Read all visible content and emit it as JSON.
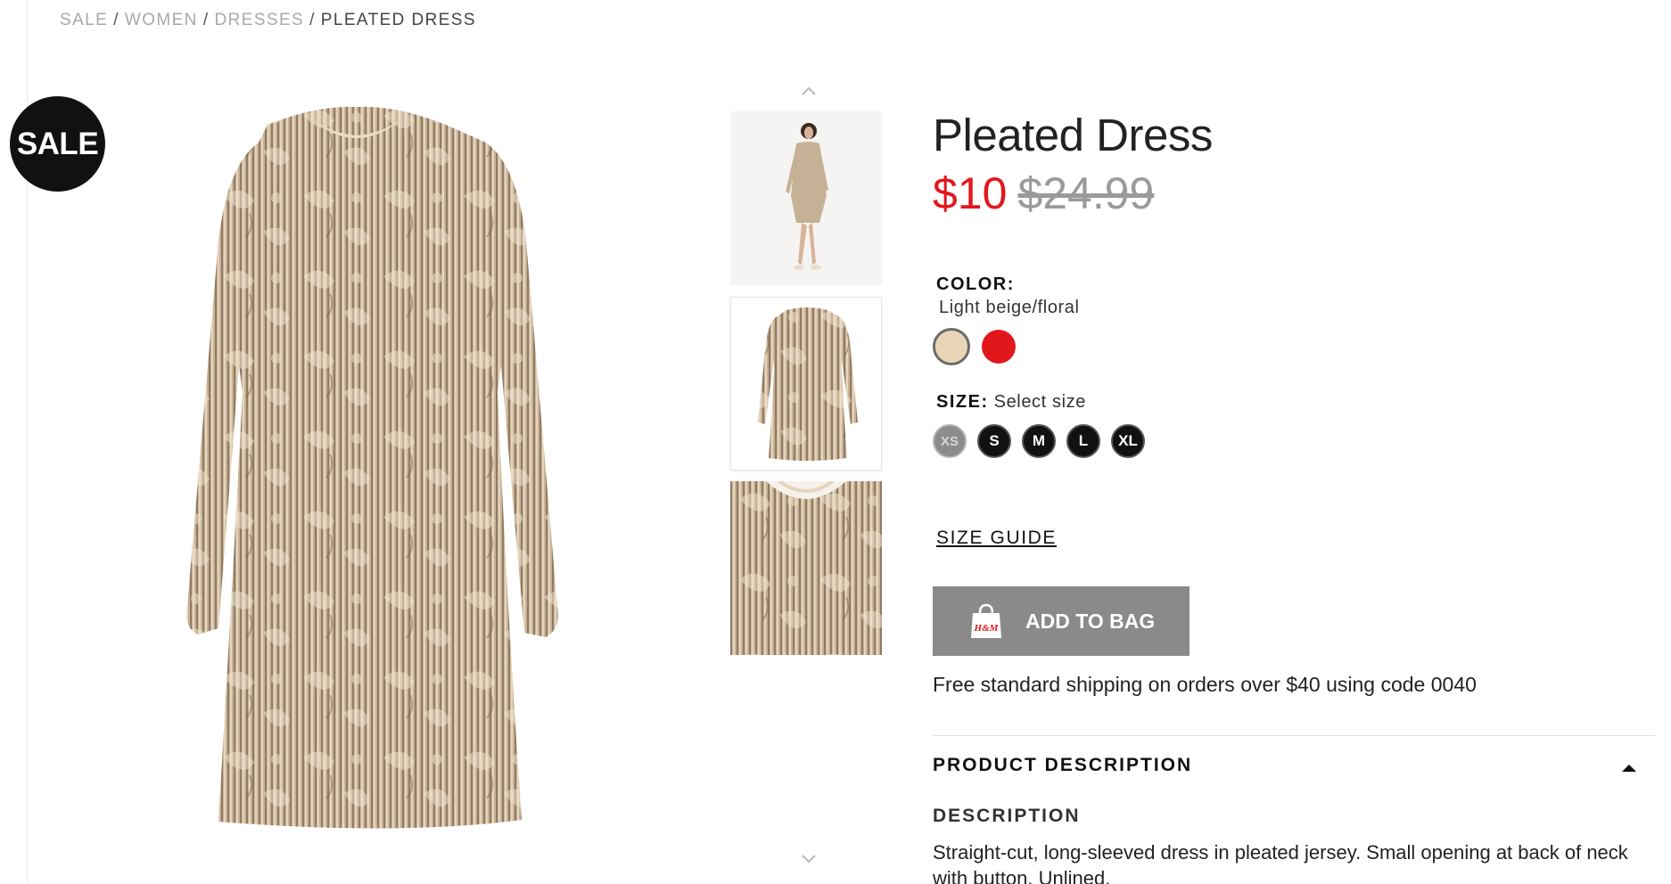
{
  "breadcrumb": {
    "items": [
      "SALE",
      "WOMEN",
      "DRESSES"
    ],
    "current": "PLEATED DRESS",
    "separator": "/"
  },
  "badge": {
    "label": "SALE"
  },
  "gallery": {
    "thumbnails": [
      "model-front-view",
      "dress-front-view",
      "dress-detail-view"
    ],
    "up_icon": "chevron-up-icon",
    "down_icon": "chevron-down-icon"
  },
  "product": {
    "title": "Pleated Dress",
    "sale_price": "$10",
    "original_price": "$24.99",
    "sale_color": "#e2171c"
  },
  "color": {
    "label": "COLOR:",
    "selected_name": "Light beige/floral",
    "swatches": [
      {
        "name": "Light beige/floral",
        "hex": "#ead5b6",
        "selected": true
      },
      {
        "name": "Red",
        "hex": "#e2171c",
        "selected": false
      }
    ]
  },
  "size": {
    "label": "SIZE:",
    "hint": "Select size",
    "options": [
      {
        "label": "XS",
        "available": false
      },
      {
        "label": "S",
        "available": true
      },
      {
        "label": "M",
        "available": true
      },
      {
        "label": "L",
        "available": true
      },
      {
        "label": "XL",
        "available": true
      }
    ]
  },
  "size_guide": {
    "label": "SIZE GUIDE"
  },
  "add_to_bag": {
    "label": "ADD TO BAG",
    "icon": "shopping-bag-icon",
    "icon_text": "H&M"
  },
  "shipping": {
    "text": "Free standard shipping on orders over $40 using code 0040"
  },
  "product_description": {
    "header": "PRODUCT DESCRIPTION",
    "toggle_icon": "caret-up-icon",
    "description_title": "DESCRIPTION",
    "description_text": "Straight-cut, long-sleeved dress in pleated jersey. Small opening at back of neck with button. Unlined."
  }
}
